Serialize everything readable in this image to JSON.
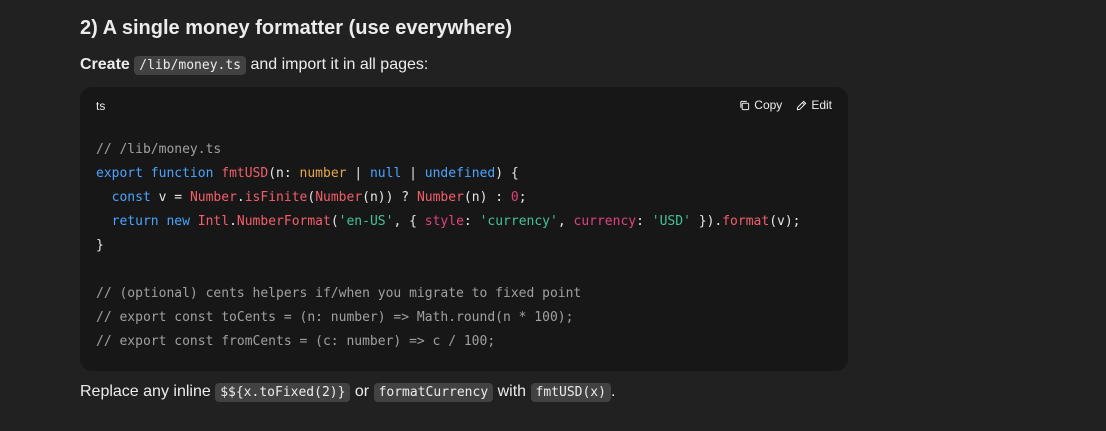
{
  "section": {
    "heading": "2) A single money formatter (use everywhere)"
  },
  "intro": {
    "bold": "Create",
    "file_path": "/lib/money.ts",
    "rest": "and import it in all pages:"
  },
  "code_block": {
    "language": "ts",
    "copy_label": "Copy",
    "edit_label": "Edit",
    "lines": [
      [
        {
          "t": "comment",
          "v": "// /lib/money.ts"
        }
      ],
      [
        {
          "t": "keyword",
          "v": "export"
        },
        {
          "t": "plain",
          "v": " "
        },
        {
          "t": "keyword",
          "v": "function"
        },
        {
          "t": "plain",
          "v": " "
        },
        {
          "t": "func",
          "v": "fmtUSD"
        },
        {
          "t": "plain",
          "v": "(n: "
        },
        {
          "t": "type",
          "v": "number"
        },
        {
          "t": "plain",
          "v": " | "
        },
        {
          "t": "keyword",
          "v": "null"
        },
        {
          "t": "plain",
          "v": " | "
        },
        {
          "t": "keyword",
          "v": "undefined"
        },
        {
          "t": "plain",
          "v": ") {"
        }
      ],
      [
        {
          "t": "plain",
          "v": "  "
        },
        {
          "t": "keyword",
          "v": "const"
        },
        {
          "t": "plain",
          "v": " v = "
        },
        {
          "t": "func",
          "v": "Number"
        },
        {
          "t": "plain",
          "v": "."
        },
        {
          "t": "func",
          "v": "isFinite"
        },
        {
          "t": "plain",
          "v": "("
        },
        {
          "t": "func",
          "v": "Number"
        },
        {
          "t": "plain",
          "v": "(n)) ? "
        },
        {
          "t": "func",
          "v": "Number"
        },
        {
          "t": "plain",
          "v": "(n) : "
        },
        {
          "t": "num",
          "v": "0"
        },
        {
          "t": "plain",
          "v": ";"
        }
      ],
      [
        {
          "t": "plain",
          "v": "  "
        },
        {
          "t": "keyword",
          "v": "return"
        },
        {
          "t": "plain",
          "v": " "
        },
        {
          "t": "keyword",
          "v": "new"
        },
        {
          "t": "plain",
          "v": " "
        },
        {
          "t": "func",
          "v": "Intl"
        },
        {
          "t": "plain",
          "v": "."
        },
        {
          "t": "func",
          "v": "NumberFormat"
        },
        {
          "t": "plain",
          "v": "("
        },
        {
          "t": "string",
          "v": "'en-US'"
        },
        {
          "t": "plain",
          "v": ", { "
        },
        {
          "t": "prop",
          "v": "style"
        },
        {
          "t": "plain",
          "v": ": "
        },
        {
          "t": "string",
          "v": "'currency'"
        },
        {
          "t": "plain",
          "v": ", "
        },
        {
          "t": "prop",
          "v": "currency"
        },
        {
          "t": "plain",
          "v": ": "
        },
        {
          "t": "string",
          "v": "'USD'"
        },
        {
          "t": "plain",
          "v": " })."
        },
        {
          "t": "func",
          "v": "format"
        },
        {
          "t": "plain",
          "v": "(v);"
        }
      ],
      [
        {
          "t": "plain",
          "v": "}"
        }
      ],
      [
        {
          "t": "plain",
          "v": ""
        }
      ],
      [
        {
          "t": "comment",
          "v": "// (optional) cents helpers if/when you migrate to fixed point"
        }
      ],
      [
        {
          "t": "comment",
          "v": "// export const toCents = (n: number) => Math.round(n * 100);"
        }
      ],
      [
        {
          "t": "comment",
          "v": "// export const fromCents = (c: number) => c / 100;"
        }
      ]
    ]
  },
  "outro": {
    "prefix": "Replace any inline",
    "code1": "$${x.toFixed(2)}",
    "or": "or",
    "code2": "formatCurrency",
    "with": "with",
    "code3": "fmtUSD(x)",
    "suffix": "."
  }
}
